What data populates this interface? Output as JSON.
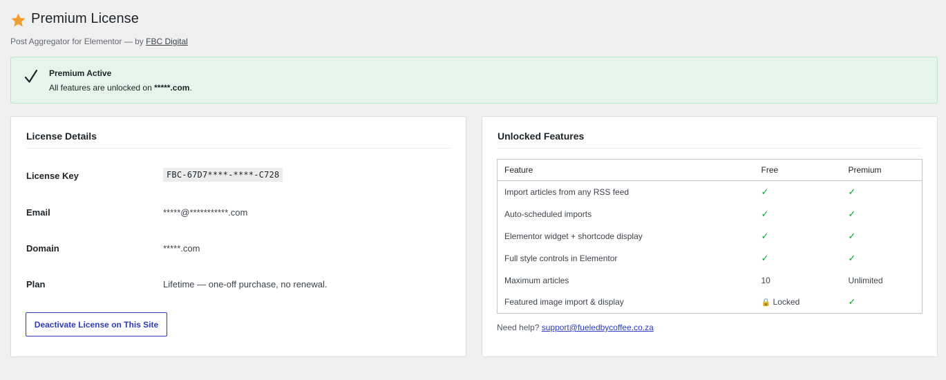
{
  "header": {
    "title": "Premium License",
    "subtitle_prefix": "Post Aggregator for Elementor — by",
    "author_link": "FBC Digital"
  },
  "notice": {
    "title": "Premium Active",
    "text_prefix": "All features are unlocked on",
    "domain": "*****.com",
    "text_suffix": "."
  },
  "license_details": {
    "title": "License Details",
    "rows": [
      {
        "label": "License Key",
        "value": "FBC-67D7****-****-C728"
      },
      {
        "label": "Email",
        "value": "*****@***********.com"
      },
      {
        "label": "Domain",
        "value": "*****.com"
      },
      {
        "label": "Plan",
        "value": "Lifetime — one-off purchase, no renewal."
      }
    ],
    "deactivate_label": "Deactivate License on This Site"
  },
  "features": {
    "title": "Unlocked Features",
    "columns": [
      "Feature",
      "Free",
      "Premium"
    ],
    "rows": [
      {
        "feature": "Import articles from any RSS feed",
        "free": "✓",
        "premium": "✓"
      },
      {
        "feature": "Auto-scheduled imports",
        "free": "✓",
        "premium": "✓"
      },
      {
        "feature": "Elementor widget + shortcode display",
        "free": "✓",
        "premium": "✓"
      },
      {
        "feature": "Full style controls in Elementor",
        "free": "✓",
        "premium": "✓"
      },
      {
        "feature": "Maximum articles",
        "free": "10",
        "premium": "Unlimited"
      },
      {
        "feature": "Featured image import & display",
        "free_icon": "🔒",
        "free": "Locked",
        "premium": "✓"
      }
    ],
    "help_prefix": "Need help?",
    "help_email": "support@fueledbycoffee.co.za"
  },
  "colors": {
    "accent": "#2c3cbc",
    "check": "#00a32a",
    "star": "#f0a030",
    "notice_bg": "#e6f5ec"
  },
  "icons": [
    "star-icon",
    "checkmark-icon",
    "lock-icon"
  ]
}
